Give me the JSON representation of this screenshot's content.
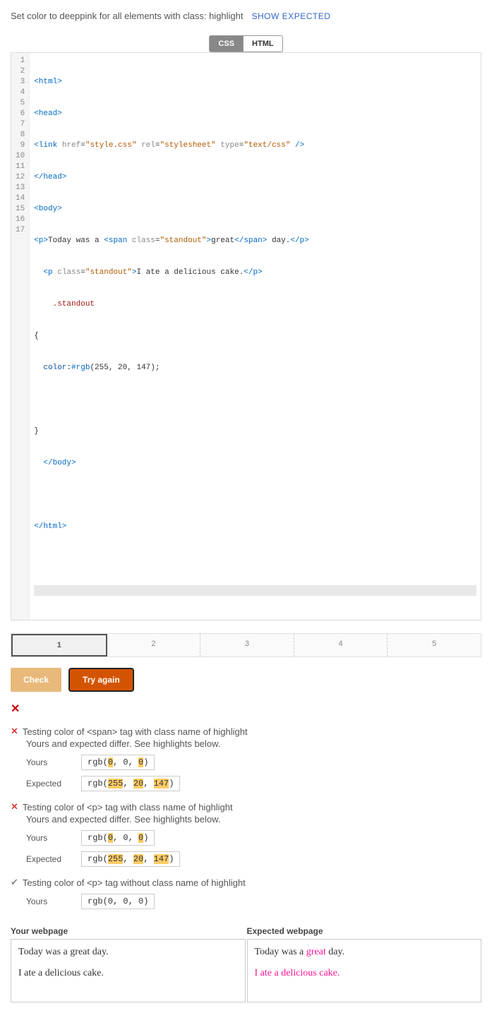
{
  "instruction": "Set color to deeppink for all elements with class: highlight",
  "show_expected_label": "SHOW EXPECTED",
  "code_tabs": {
    "css": "CSS",
    "html": "HTML"
  },
  "editor": {
    "lines": [
      "<html>",
      "<head>",
      "<link href=\"style.css\" rel=\"stylesheet\" type=\"text/css\" />",
      "</head>",
      "<body>",
      "<p>Today was a <span class=\"standout\">great</span> day.</p>",
      "  <p class=\"standout\">I ate a delicious cake.</p>",
      "    .standout",
      "{",
      "  color:#rgb(255, 20, 147);",
      "",
      "}",
      "  </body>",
      "",
      "</html>",
      "",
      ""
    ]
  },
  "step_tabs": [
    "1",
    "2",
    "3",
    "4",
    "5"
  ],
  "buttons": {
    "check": "Check",
    "try_again": "Try again"
  },
  "tests": [
    {
      "status": "fail",
      "title": "Testing color of <span> tag with class name of highlight",
      "sub": "Yours and expected differ. See highlights below.",
      "yours_label": "Yours",
      "yours_value_pre": "rgb(",
      "yours_value_a": "0",
      "yours_value_mid1": ", 0, ",
      "yours_value_b": "0",
      "yours_value_post": ")",
      "expected_label": "Expected",
      "expected_value_pre": "rgb(",
      "expected_value_a": "255",
      "expected_value_mid1": ", ",
      "expected_value_b": "20",
      "expected_value_mid2": ", ",
      "expected_value_c": "147",
      "expected_value_post": ")"
    },
    {
      "status": "fail",
      "title": "Testing color of <p> tag with class name of highlight",
      "sub": "Yours and expected differ. See highlights below.",
      "yours_label": "Yours",
      "yours_value_pre": "rgb(",
      "yours_value_a": "0",
      "yours_value_mid1": ", 0, ",
      "yours_value_b": "0",
      "yours_value_post": ")",
      "expected_label": "Expected",
      "expected_value_pre": "rgb(",
      "expected_value_a": "255",
      "expected_value_mid1": ", ",
      "expected_value_b": "20",
      "expected_value_mid2": ", ",
      "expected_value_c": "147",
      "expected_value_post": ")"
    },
    {
      "status": "pass",
      "title": "Testing color of <p> tag without class name of highlight",
      "yours_label": "Yours",
      "yours_full": "rgb(0, 0, 0)"
    }
  ],
  "webpage": {
    "your_header": "Your webpage",
    "expected_header": "Expected webpage",
    "line1_pre": "Today was a ",
    "line1_word": "great",
    "line1_post": " day.",
    "line2": "I ate a delicious cake."
  }
}
